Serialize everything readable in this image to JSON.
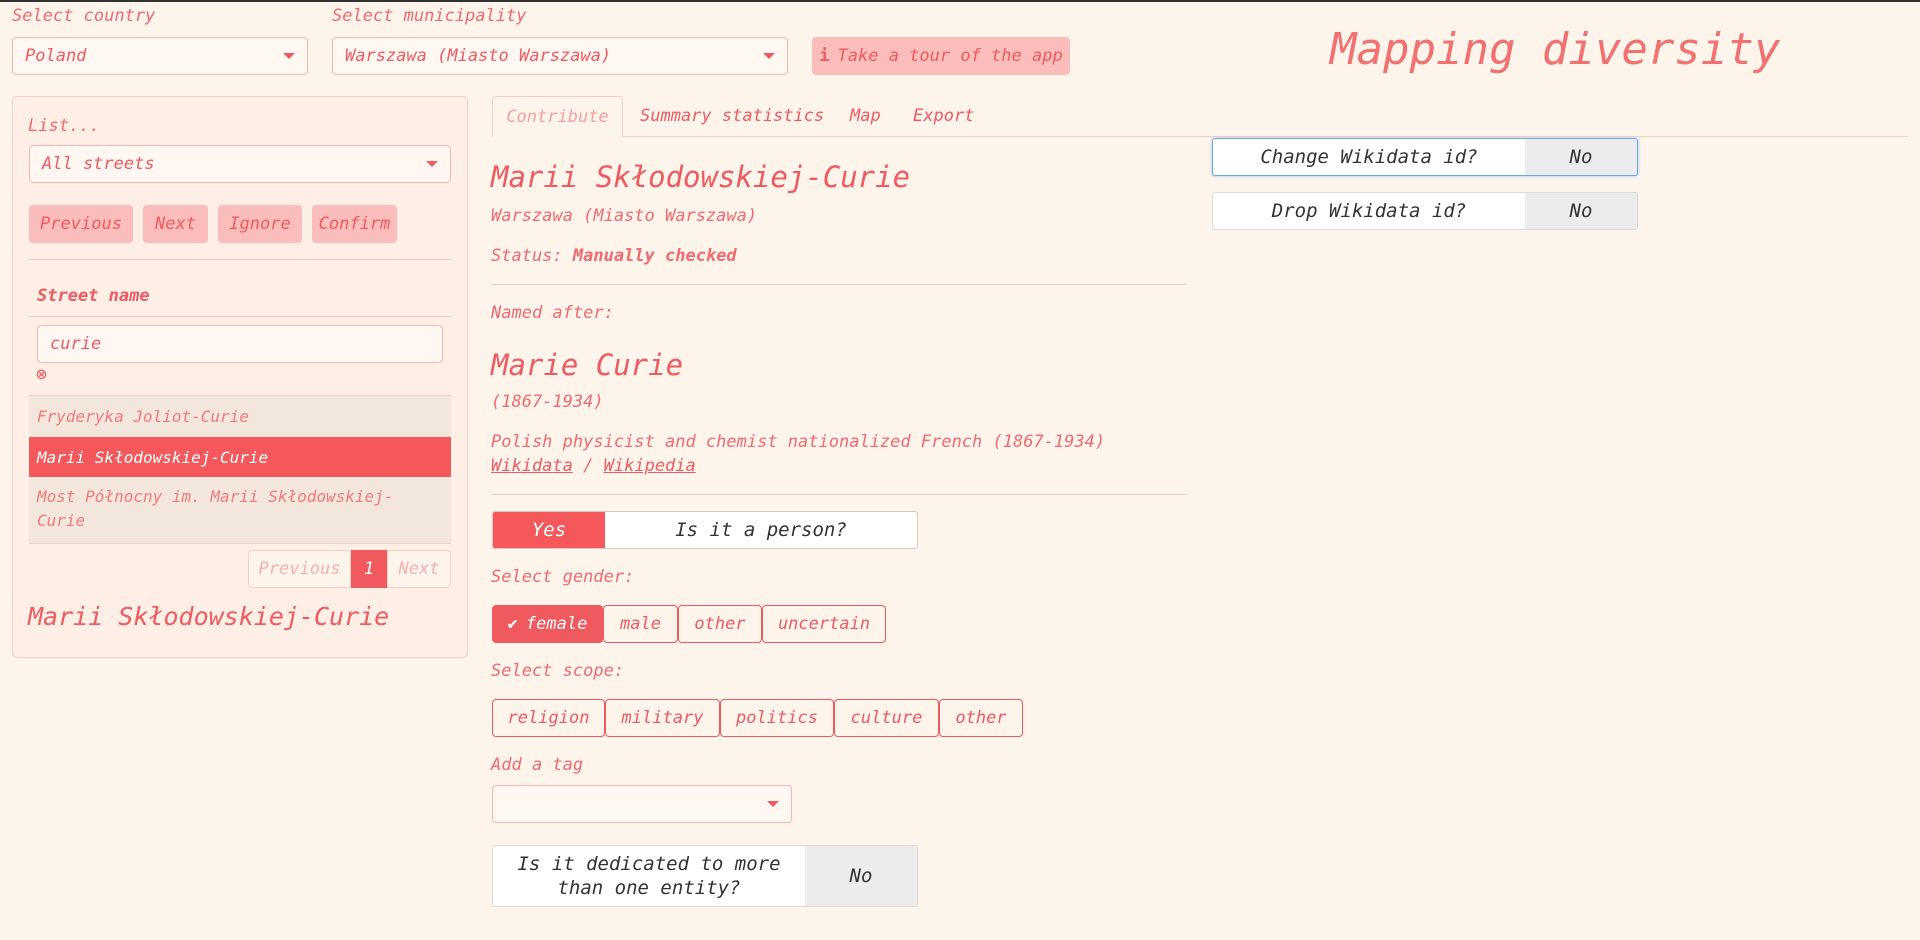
{
  "header": {
    "country_label": "Select country",
    "country_value": "Poland",
    "municipality_label": "Select municipality",
    "municipality_value": "Warszawa (Miasto Warszawa)",
    "tour_icon": "i",
    "tour_label": "Take a tour of the app",
    "app_title": "Mapping diversity"
  },
  "sidebar": {
    "list_label": "List...",
    "list_value": "All streets",
    "buttons": {
      "previous": "Previous",
      "next": "Next",
      "ignore": "Ignore",
      "confirm": "Confirm"
    },
    "column_header": "Street name",
    "search_value": "curie",
    "clear_icon": "⊗",
    "rows": [
      "Fryderyka Joliot-Curie",
      "Marii Skłodowskiej-Curie",
      "Most Północny im. Marii Skłodowskiej-Curie"
    ],
    "pagination": {
      "previous": "Previous",
      "page": "1",
      "next": "Next"
    },
    "selected_name": "Marii Skłodowskiej-Curie"
  },
  "tabs": [
    "Contribute",
    "Summary statistics",
    "Map",
    "Export"
  ],
  "detail": {
    "street_name": "Marii Skłodowskiej-Curie",
    "municipality": "Warszawa (Miasto Warszawa)",
    "status_label": "Status:",
    "status_value": "Manually checked",
    "named_after_label": "Named after:",
    "person_name": "Marie Curie",
    "person_dates": "(1867-1934)",
    "person_description": "Polish physicist and chemist nationalized French (1867-1934)",
    "wikidata_link": "Wikidata",
    "link_separator": "/",
    "wikipedia_link": "Wikipedia",
    "person_toggle": {
      "value": "Yes",
      "question": "Is it a person?"
    },
    "gender_label": "Select gender:",
    "gender_options": [
      "female",
      "male",
      "other",
      "uncertain"
    ],
    "scope_label": "Select scope:",
    "scope_options": [
      "religion",
      "military",
      "politics",
      "culture",
      "other"
    ],
    "tag_label": "Add a tag",
    "multi_toggle": {
      "question": "Is it dedicated to more than one entity?",
      "value": "No"
    }
  },
  "wikidata": {
    "change": {
      "question": "Change Wikidata id?",
      "value": "No"
    },
    "drop": {
      "question": "Drop Wikidata id?",
      "value": "No"
    }
  },
  "colors": {
    "accent": "#f05a5f",
    "background": "#fdf4ec",
    "button_pink": "#fbbcbc"
  }
}
